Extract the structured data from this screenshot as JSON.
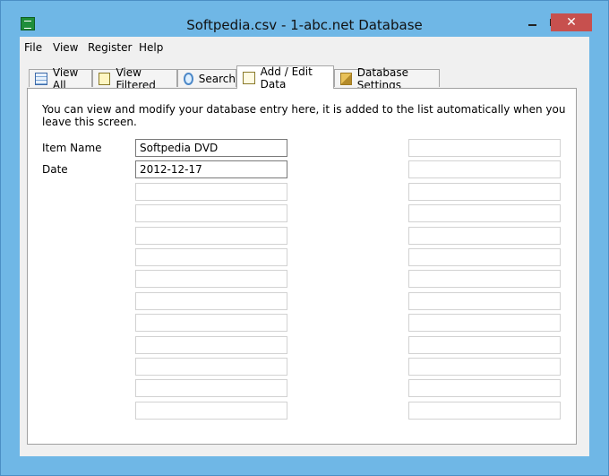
{
  "window": {
    "title": "Softpedia.csv - 1-abc.net Database",
    "close_glyph": "✕"
  },
  "menu": [
    "File",
    "View",
    "Register",
    "Help"
  ],
  "tabs": [
    {
      "label": "View All",
      "icon": "table-icon"
    },
    {
      "label": "View Filtered",
      "icon": "filter-icon"
    },
    {
      "label": "Search",
      "icon": "magnifier-icon"
    },
    {
      "label": "Add / Edit Data",
      "icon": "edit-icon",
      "active": true
    },
    {
      "label": "Database Settings",
      "icon": "wrench-icon"
    }
  ],
  "panel": {
    "instruction": "You can view and modify your database entry here, it is added to the list automatically when you leave this screen.",
    "fields": [
      {
        "label": "Item Name",
        "value": "Softpedia DVD"
      },
      {
        "label": "Date",
        "value": "2012-12-17"
      },
      {
        "label": "",
        "value": ""
      },
      {
        "label": "",
        "value": ""
      },
      {
        "label": "",
        "value": ""
      },
      {
        "label": "",
        "value": ""
      },
      {
        "label": "",
        "value": ""
      },
      {
        "label": "",
        "value": ""
      },
      {
        "label": "",
        "value": ""
      },
      {
        "label": "",
        "value": ""
      },
      {
        "label": "",
        "value": ""
      },
      {
        "label": "",
        "value": ""
      },
      {
        "label": "",
        "value": ""
      }
    ],
    "right_fields": [
      "",
      "",
      "",
      "",
      "",
      "",
      "",
      "",
      "",
      "",
      "",
      "",
      ""
    ]
  }
}
